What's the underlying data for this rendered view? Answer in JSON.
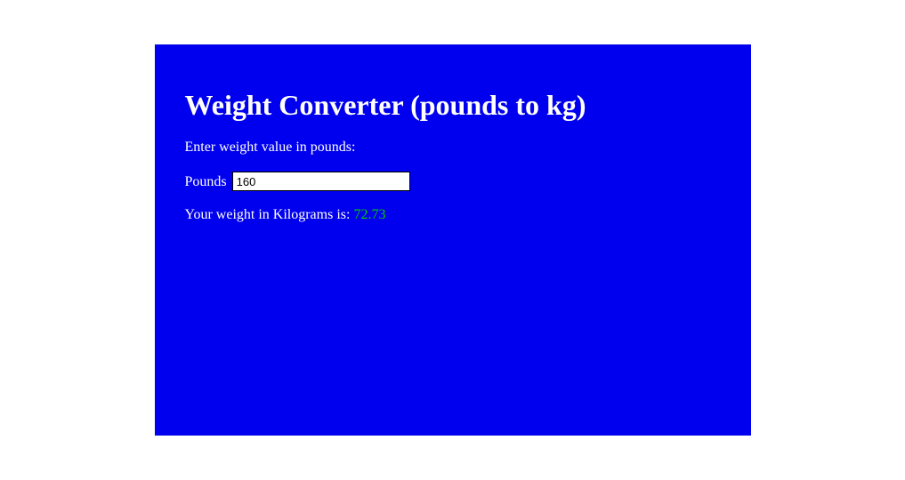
{
  "title": "Weight Converter (pounds to kg)",
  "prompt": "Enter weight value in pounds:",
  "input": {
    "label": "Pounds",
    "value": "160"
  },
  "result": {
    "prefix": "Your weight in Kilograms is: ",
    "value": "72.73"
  }
}
